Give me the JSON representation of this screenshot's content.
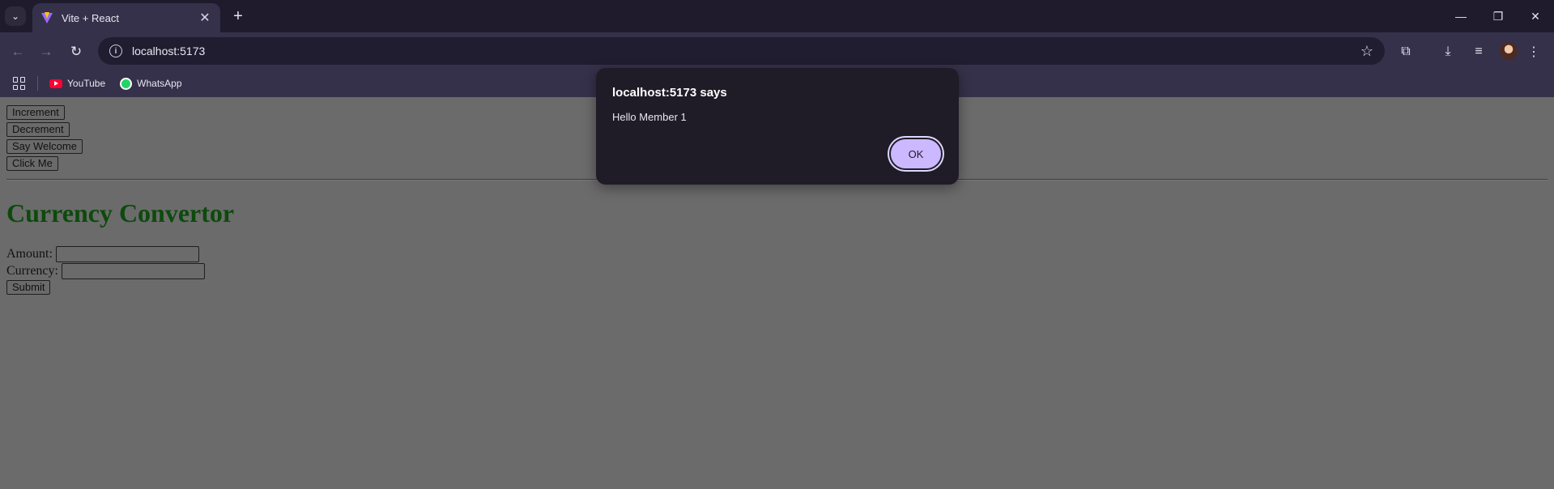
{
  "browser": {
    "tab": {
      "title": "Vite + React"
    },
    "address": {
      "url": "localhost:5173"
    },
    "bookmarks": [
      {
        "label": "YouTube",
        "icon": "youtube-icon"
      },
      {
        "label": "WhatsApp",
        "icon": "whatsapp-icon"
      }
    ]
  },
  "page": {
    "buttons": [
      "Increment",
      "Decrement",
      "Say Welcome",
      "Click Me"
    ],
    "heading": "Currency Convertor",
    "heading_color": "#0d4a0d",
    "form": {
      "amount_label": "Amount:",
      "amount_value": "",
      "currency_label": "Currency:",
      "currency_value": "",
      "submit_label": "Submit"
    }
  },
  "alert": {
    "title": "localhost:5173 says",
    "message": "Hello Member 1",
    "ok_label": "OK",
    "accent": "#cbb8ff"
  }
}
